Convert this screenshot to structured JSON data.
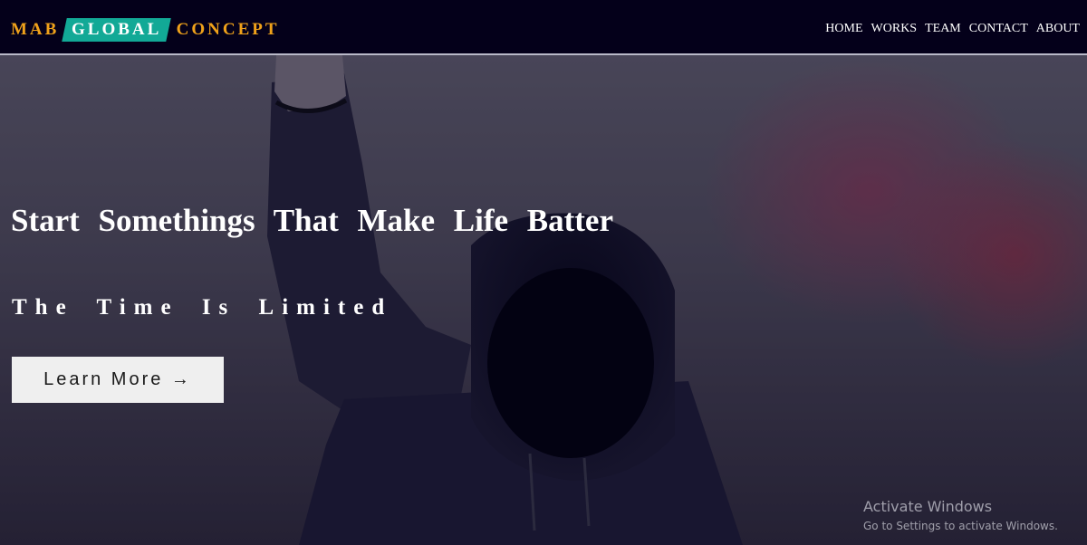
{
  "brand": {
    "part1": "MAB",
    "part2": "GLOBAL",
    "part3": "CONCEPT",
    "colors": {
      "accent": "#f0a21a",
      "highlight": "#12a996",
      "nav_bg": "#04001a"
    }
  },
  "nav": {
    "items": [
      {
        "label": "HOME"
      },
      {
        "label": "WORKS"
      },
      {
        "label": "TEAM"
      },
      {
        "label": "CONTACT"
      },
      {
        "label": "ABOUT"
      }
    ]
  },
  "hero": {
    "headline": "Start Somethings That Make Life Batter",
    "subline": "The Time Is Limited",
    "cta_label": "Learn More →"
  },
  "watermark": {
    "title": "Activate Windows",
    "subtitle": "Go to Settings to activate Windows."
  }
}
